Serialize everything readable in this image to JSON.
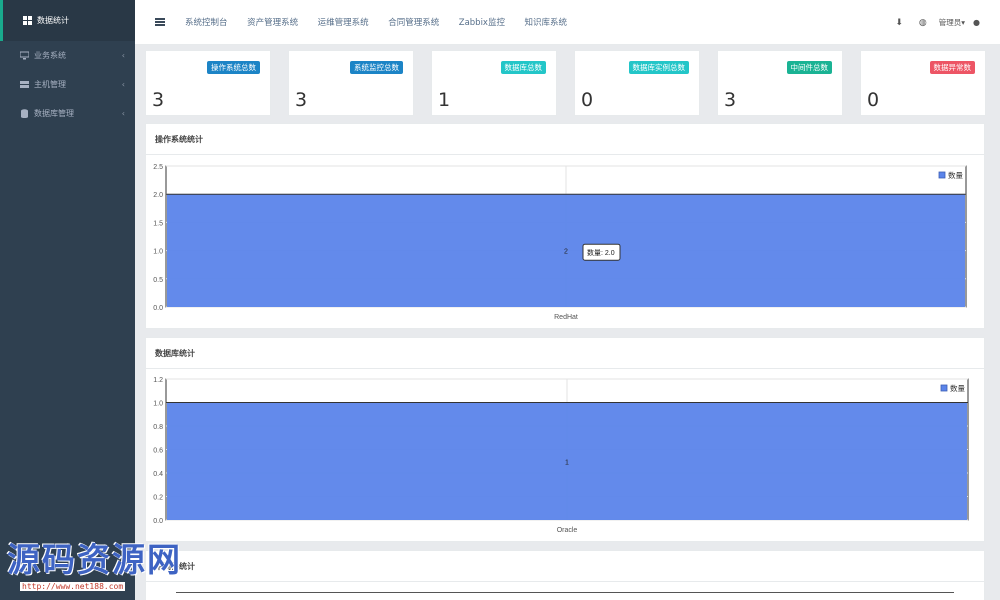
{
  "sidebar": {
    "items": [
      {
        "label": "数据统计",
        "icon": "grid-icon"
      },
      {
        "label": "业务系统",
        "icon": "monitor-icon"
      },
      {
        "label": "主机管理",
        "icon": "server-icon"
      },
      {
        "label": "数据库管理",
        "icon": "database-icon"
      }
    ]
  },
  "topbar": {
    "links": [
      "系统控制台",
      "资产管理系统",
      "运维管理系统",
      "合同管理系统",
      "Zabbix监控",
      "知识库系统"
    ],
    "admin": "管理员▾"
  },
  "cards": [
    {
      "label": "操作系统总数",
      "value": "3",
      "color": "#1c84c6"
    },
    {
      "label": "系统监控总数",
      "value": "3",
      "color": "#1c84c6"
    },
    {
      "label": "数据库总数",
      "value": "1",
      "color": "#23c6c8"
    },
    {
      "label": "数据库实例总数",
      "value": "0",
      "color": "#23c6c8"
    },
    {
      "label": "中间件总数",
      "value": "3",
      "color": "#1ab394"
    },
    {
      "label": "数据异常数",
      "value": "0",
      "color": "#ed5565"
    }
  ],
  "panels": [
    {
      "title": "操作系统统计"
    },
    {
      "title": "数据库统计"
    },
    {
      "title": "中间件统计"
    }
  ],
  "chart_data": [
    {
      "type": "bar",
      "categories": [
        "RedHat"
      ],
      "series": [
        {
          "name": "数量",
          "values": [
            2
          ]
        }
      ],
      "ylim": [
        0,
        2.5
      ],
      "yticks": [
        "0.0",
        "0.5",
        "1.0",
        "1.5",
        "2.0",
        "2.5"
      ],
      "data_label": "2",
      "tooltip": "数量: 2.0",
      "legend": "top-right",
      "color": "#5b84ea"
    },
    {
      "type": "bar",
      "categories": [
        "Oracle"
      ],
      "series": [
        {
          "name": "数量",
          "values": [
            1
          ]
        }
      ],
      "ylim": [
        0,
        1.2
      ],
      "yticks": [
        "0.0",
        "0.2",
        "0.4",
        "0.6",
        "0.8",
        "1.0",
        "1.2"
      ],
      "data_label": "1",
      "legend": "top-right",
      "color": "#5b84ea"
    }
  ],
  "watermark": {
    "text": "源码资源网",
    "url": "http://www.net188.com"
  }
}
